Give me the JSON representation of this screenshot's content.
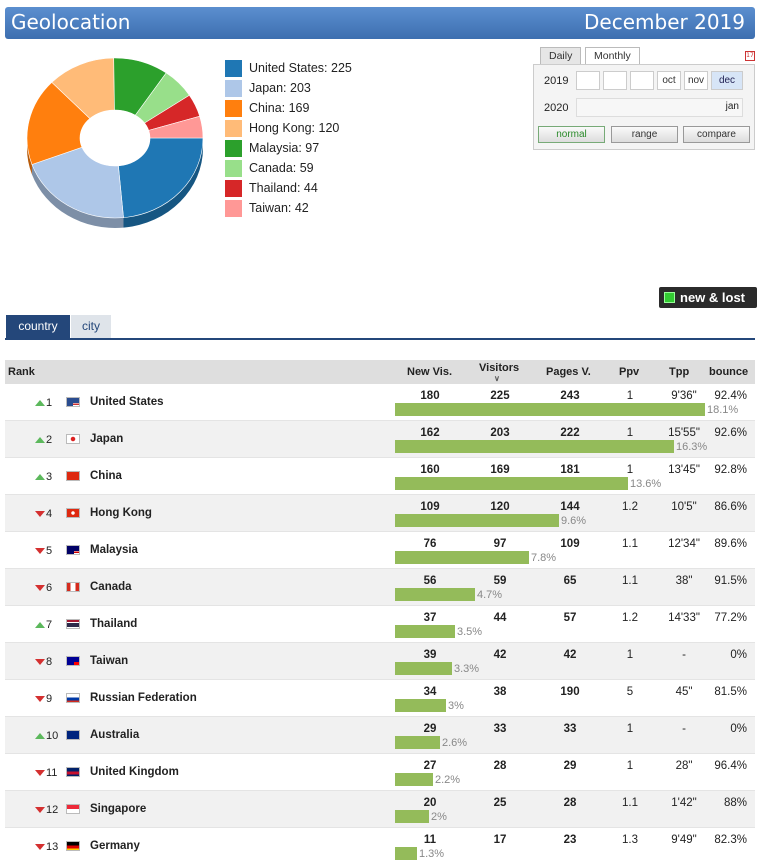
{
  "header": {
    "title": "Geolocation",
    "period": "December 2019"
  },
  "legend": [
    {
      "label": "United States: 225",
      "color": "#1f77b4"
    },
    {
      "label": "Japan: 203",
      "color": "#aec7e8"
    },
    {
      "label": "China: 169",
      "color": "#ff7f0e"
    },
    {
      "label": "Hong Kong: 120",
      "color": "#ffbb78"
    },
    {
      "label": "Malaysia: 97",
      "color": "#2ca02c"
    },
    {
      "label": "Canada: 59",
      "color": "#98df8a"
    },
    {
      "label": "Thailand: 44",
      "color": "#d62728"
    },
    {
      "label": "Taiwan: 42",
      "color": "#ff9896"
    }
  ],
  "pie_values": [
    225,
    203,
    169,
    120,
    97,
    59,
    44,
    42
  ],
  "datepicker": {
    "tabs": [
      "Daily",
      "Monthly"
    ],
    "year1": "2019",
    "year2": "2020",
    "months1": [
      "oct",
      "nov",
      "dec"
    ],
    "month2": "jan",
    "buttons": [
      "normal",
      "range",
      "compare"
    ]
  },
  "new_lost_label": "new & lost",
  "tabs": {
    "country": "country",
    "city": "city"
  },
  "columns": {
    "rank": "Rank",
    "new_vis": "New Vis.",
    "visitors": "Visitors",
    "pages": "Pages V.",
    "ppv": "Ppv",
    "tpp": "Tpp",
    "bounce": "bounce"
  },
  "rows": [
    {
      "rank": "1",
      "dir": "up",
      "flag": "us",
      "country": "United States",
      "new": "180",
      "vis": "225",
      "pages": "243",
      "ppv": "1",
      "tpp": "9'36\"",
      "bounce": "92.4%",
      "pct": "18.1%",
      "share": 18.1
    },
    {
      "rank": "2",
      "dir": "up",
      "flag": "jp",
      "country": "Japan",
      "new": "162",
      "vis": "203",
      "pages": "222",
      "ppv": "1",
      "tpp": "15'55\"",
      "bounce": "92.6%",
      "pct": "16.3%",
      "share": 16.3
    },
    {
      "rank": "3",
      "dir": "up",
      "flag": "cn",
      "country": "China",
      "new": "160",
      "vis": "169",
      "pages": "181",
      "ppv": "1",
      "tpp": "13'45\"",
      "bounce": "92.8%",
      "pct": "13.6%",
      "share": 13.6
    },
    {
      "rank": "4",
      "dir": "down",
      "flag": "hk",
      "country": "Hong Kong",
      "new": "109",
      "vis": "120",
      "pages": "144",
      "ppv": "1.2",
      "tpp": "10'5\"",
      "bounce": "86.6%",
      "pct": "9.6%",
      "share": 9.6
    },
    {
      "rank": "5",
      "dir": "down",
      "flag": "my",
      "country": "Malaysia",
      "new": "76",
      "vis": "97",
      "pages": "109",
      "ppv": "1.1",
      "tpp": "12'34\"",
      "bounce": "89.6%",
      "pct": "7.8%",
      "share": 7.8
    },
    {
      "rank": "6",
      "dir": "down",
      "flag": "ca",
      "country": "Canada",
      "new": "56",
      "vis": "59",
      "pages": "65",
      "ppv": "1.1",
      "tpp": "38\"",
      "bounce": "91.5%",
      "pct": "4.7%",
      "share": 4.7
    },
    {
      "rank": "7",
      "dir": "up",
      "flag": "th",
      "country": "Thailand",
      "new": "37",
      "vis": "44",
      "pages": "57",
      "ppv": "1.2",
      "tpp": "14'33\"",
      "bounce": "77.2%",
      "pct": "3.5%",
      "share": 3.5
    },
    {
      "rank": "8",
      "dir": "down",
      "flag": "tw",
      "country": "Taiwan",
      "new": "39",
      "vis": "42",
      "pages": "42",
      "ppv": "1",
      "tpp": "-",
      "bounce": "0%",
      "pct": "3.3%",
      "share": 3.3
    },
    {
      "rank": "9",
      "dir": "down",
      "flag": "ru",
      "country": "Russian Federation",
      "new": "34",
      "vis": "38",
      "pages": "190",
      "ppv": "5",
      "tpp": "45\"",
      "bounce": "81.5%",
      "pct": "3%",
      "share": 3.0
    },
    {
      "rank": "10",
      "dir": "up",
      "flag": "au",
      "country": "Australia",
      "new": "29",
      "vis": "33",
      "pages": "33",
      "ppv": "1",
      "tpp": "-",
      "bounce": "0%",
      "pct": "2.6%",
      "share": 2.6
    },
    {
      "rank": "11",
      "dir": "down",
      "flag": "gb",
      "country": "United Kingdom",
      "new": "27",
      "vis": "28",
      "pages": "29",
      "ppv": "1",
      "tpp": "28\"",
      "bounce": "96.4%",
      "pct": "2.2%",
      "share": 2.2
    },
    {
      "rank": "12",
      "dir": "down",
      "flag": "sg",
      "country": "Singapore",
      "new": "20",
      "vis": "25",
      "pages": "28",
      "ppv": "1.1",
      "tpp": "1'42\"",
      "bounce": "88%",
      "pct": "2%",
      "share": 2.0
    },
    {
      "rank": "13",
      "dir": "down",
      "flag": "de",
      "country": "Germany",
      "new": "11",
      "vis": "17",
      "pages": "23",
      "ppv": "1.3",
      "tpp": "9'49\"",
      "bounce": "82.3%",
      "pct": "1.3%",
      "share": 1.3
    }
  ]
}
